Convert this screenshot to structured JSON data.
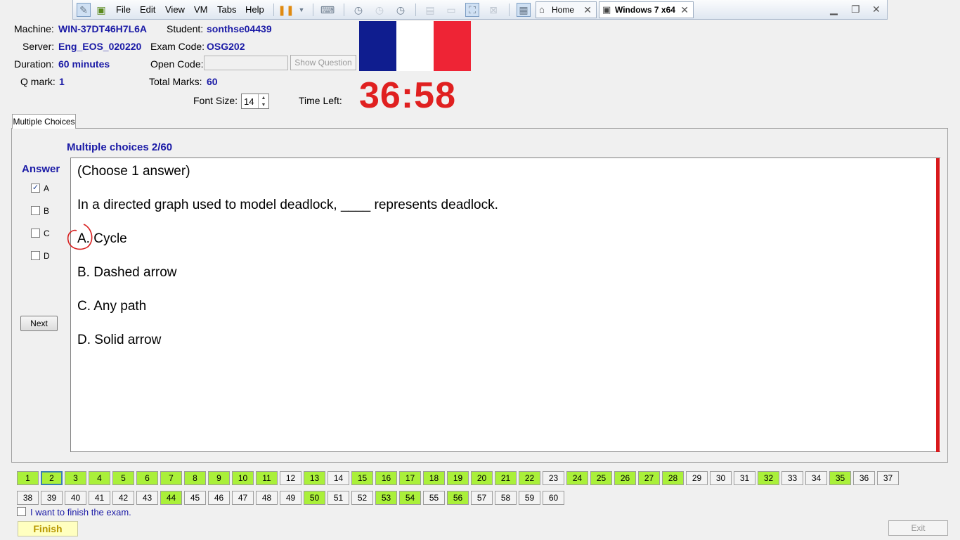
{
  "vm_toolbar": {
    "menus": [
      "File",
      "Edit",
      "View",
      "VM",
      "Tabs",
      "Help"
    ],
    "tabs": [
      {
        "label": "Home",
        "icon": "home-icon"
      },
      {
        "label": "Windows 7 x64",
        "icon": "vm-icon",
        "active": true
      }
    ]
  },
  "header": {
    "machine_label": "Machine:",
    "machine_value": "WIN-37DT46H7L6A",
    "student_label": "Student:",
    "student_value": "sonthse04439",
    "server_label": "Server:",
    "server_value": "Eng_EOS_020220",
    "exam_code_label": "Exam Code:",
    "exam_code_value": "OSG202",
    "duration_label": "Duration:",
    "duration_value": "60 minutes",
    "open_code_label": "Open Code:",
    "open_code_value": "",
    "show_question_label": "Show Question",
    "qmark_label": "Q mark:",
    "qmark_value": "1",
    "total_marks_label": "Total Marks:",
    "total_marks_value": "60",
    "font_size_label": "Font Size:",
    "font_size_value": "14",
    "time_left_label": "Time Left:",
    "time_left_value": "36:58",
    "flag_colors": [
      "#0f1d8f",
      "#ffffff",
      "#ee2435"
    ]
  },
  "exam_tab": {
    "label": "Multiple Choices",
    "question_title": "Multiple choices 2/60",
    "answer_label": "Answer",
    "options": [
      {
        "label": "A",
        "checked": true
      },
      {
        "label": "B",
        "checked": false
      },
      {
        "label": "C",
        "checked": false
      },
      {
        "label": "D",
        "checked": false
      }
    ],
    "next_label": "Next"
  },
  "question": {
    "instruction": "(Choose 1 answer)",
    "stem": "In a directed graph used to model deadlock, ____ represents deadlock.",
    "choices": [
      "A.  Cycle",
      "B.  Dashed arrow",
      "C.  Any path",
      "D.  Solid arrow"
    ]
  },
  "navigator": {
    "current": 2,
    "total": 60,
    "answered": [
      1,
      2,
      3,
      4,
      5,
      6,
      7,
      8,
      9,
      10,
      11,
      13,
      15,
      16,
      17,
      18,
      19,
      20,
      21,
      22,
      24,
      25,
      26,
      27,
      28,
      32,
      35,
      44,
      50,
      53,
      54,
      56
    ]
  },
  "footer": {
    "finish_checkbox_label": "I want to finish the exam.",
    "finish_label": "Finish",
    "exit_label": "Exit"
  }
}
